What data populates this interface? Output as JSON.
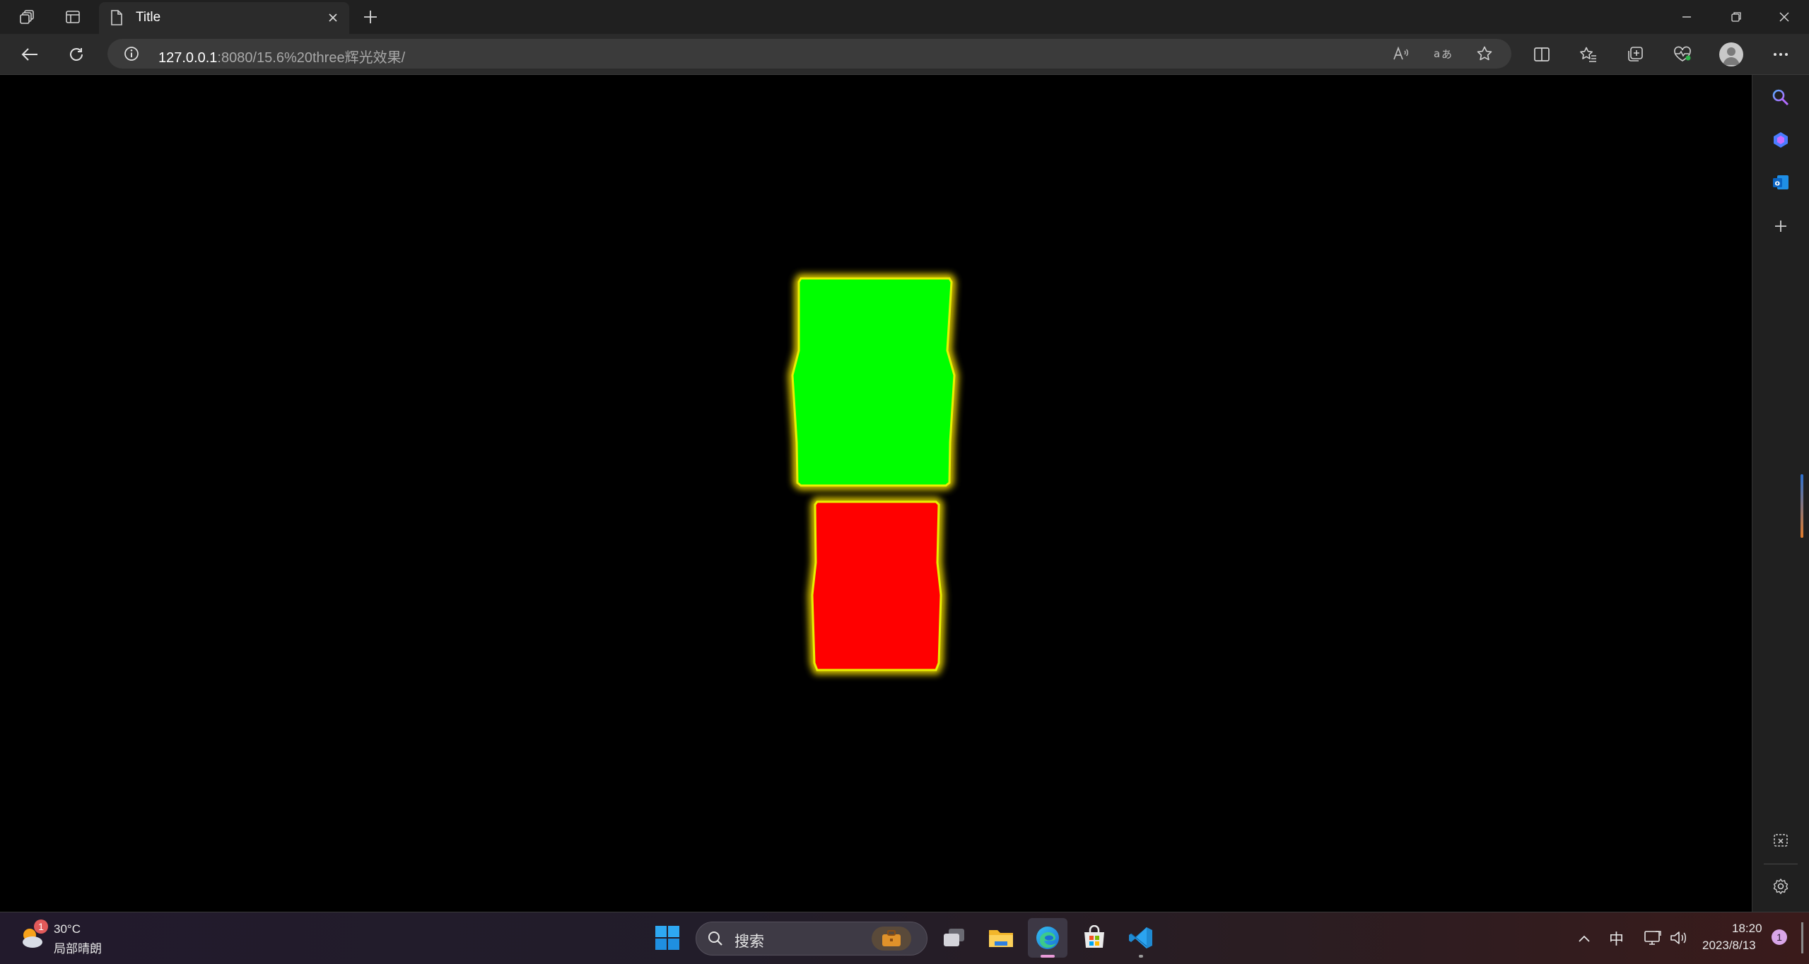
{
  "browser": {
    "tab_title": "Title",
    "url_host": "127.0.0.1",
    "url_rest": ":8080/15.6%20three辉光效果/"
  },
  "scene": {
    "top_box_color": "#00ff00",
    "bottom_box_color": "#ff0000",
    "glow_color": "#ffe600",
    "background_color": "#000000"
  },
  "taskbar": {
    "weather_temp": "30°C",
    "weather_desc": "局部晴朗",
    "weather_badge": "1",
    "search_placeholder": "搜索",
    "ime": "中",
    "time": "18:20",
    "date": "2023/8/13",
    "notification_count": "1"
  },
  "icons": {
    "workspaces": "workspaces-icon",
    "tab_actions": "tab-actions-icon",
    "page": "page-icon",
    "close": "close-icon",
    "new_tab": "plus-icon",
    "minimize": "minimize-icon",
    "restore": "restore-icon",
    "back": "back-arrow-icon",
    "refresh": "refresh-icon",
    "info": "info-icon",
    "read_aloud": "read-aloud-icon",
    "translate": "translate-icon",
    "favorite": "star-icon",
    "split_screen": "split-screen-icon",
    "favorites": "favorites-icon",
    "collections": "collections-icon",
    "performance": "heart-pulse-icon",
    "profile": "profile-icon",
    "more": "more-icon"
  }
}
